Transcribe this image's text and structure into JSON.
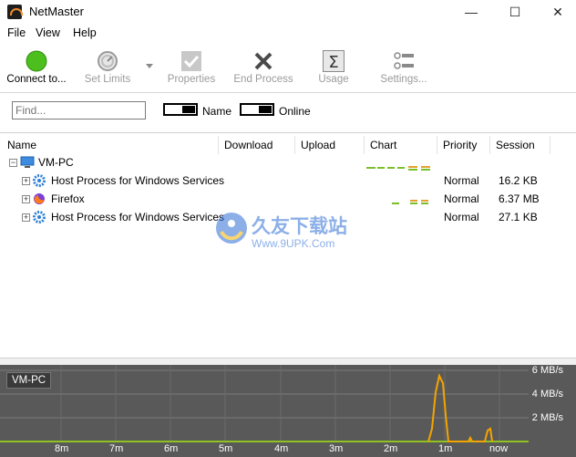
{
  "window": {
    "title": "NetMaster",
    "controls": {
      "minimize": "—",
      "maximize": "☐",
      "close": "✕"
    }
  },
  "menu": [
    "File",
    "View",
    "Help"
  ],
  "toolbar": [
    {
      "label": "Connect to...",
      "icon": "green-circle-icon",
      "enabled": true
    },
    {
      "label": "Set Limits",
      "icon": "gauge-icon",
      "enabled": false
    },
    {
      "label": "Properties",
      "icon": "checkmark-icon",
      "enabled": false
    },
    {
      "label": "End Process",
      "icon": "x-icon",
      "enabled": false
    },
    {
      "label": "Usage",
      "icon": "sigma-icon",
      "enabled": false
    },
    {
      "label": "Settings...",
      "icon": "settings-list-icon",
      "enabled": false
    }
  ],
  "filter": {
    "find_placeholder": "Find...",
    "name_toggle": "Name",
    "online_toggle": "Online"
  },
  "columns": [
    "Name",
    "Download",
    "Upload",
    "Chart",
    "Priority",
    "Session"
  ],
  "tree": {
    "root": "VM-PC",
    "rows": [
      {
        "name": "Host Process for Windows Services",
        "priority": "Normal",
        "session": "16.2 KB",
        "icon": "gear-icon"
      },
      {
        "name": "Firefox",
        "priority": "Normal",
        "session": "6.37 MB",
        "icon": "firefox-icon"
      },
      {
        "name": "Host Process for Windows Services",
        "priority": "Normal",
        "session": "27.1 KB",
        "icon": "gear-icon"
      }
    ]
  },
  "watermark": {
    "brand": "久友下载站",
    "url": "Www.9UPK.Com"
  },
  "graph": {
    "label": "VM-PC",
    "y_labels": [
      "6 MB/s",
      "4 MB/s",
      "2 MB/s"
    ],
    "x_labels": [
      "8m",
      "7m",
      "6m",
      "5m",
      "4m",
      "3m",
      "2m",
      "1m",
      "now"
    ],
    "colors": {
      "download": "#f4a400",
      "upload": "#8fc31f",
      "background": "#595959"
    }
  }
}
